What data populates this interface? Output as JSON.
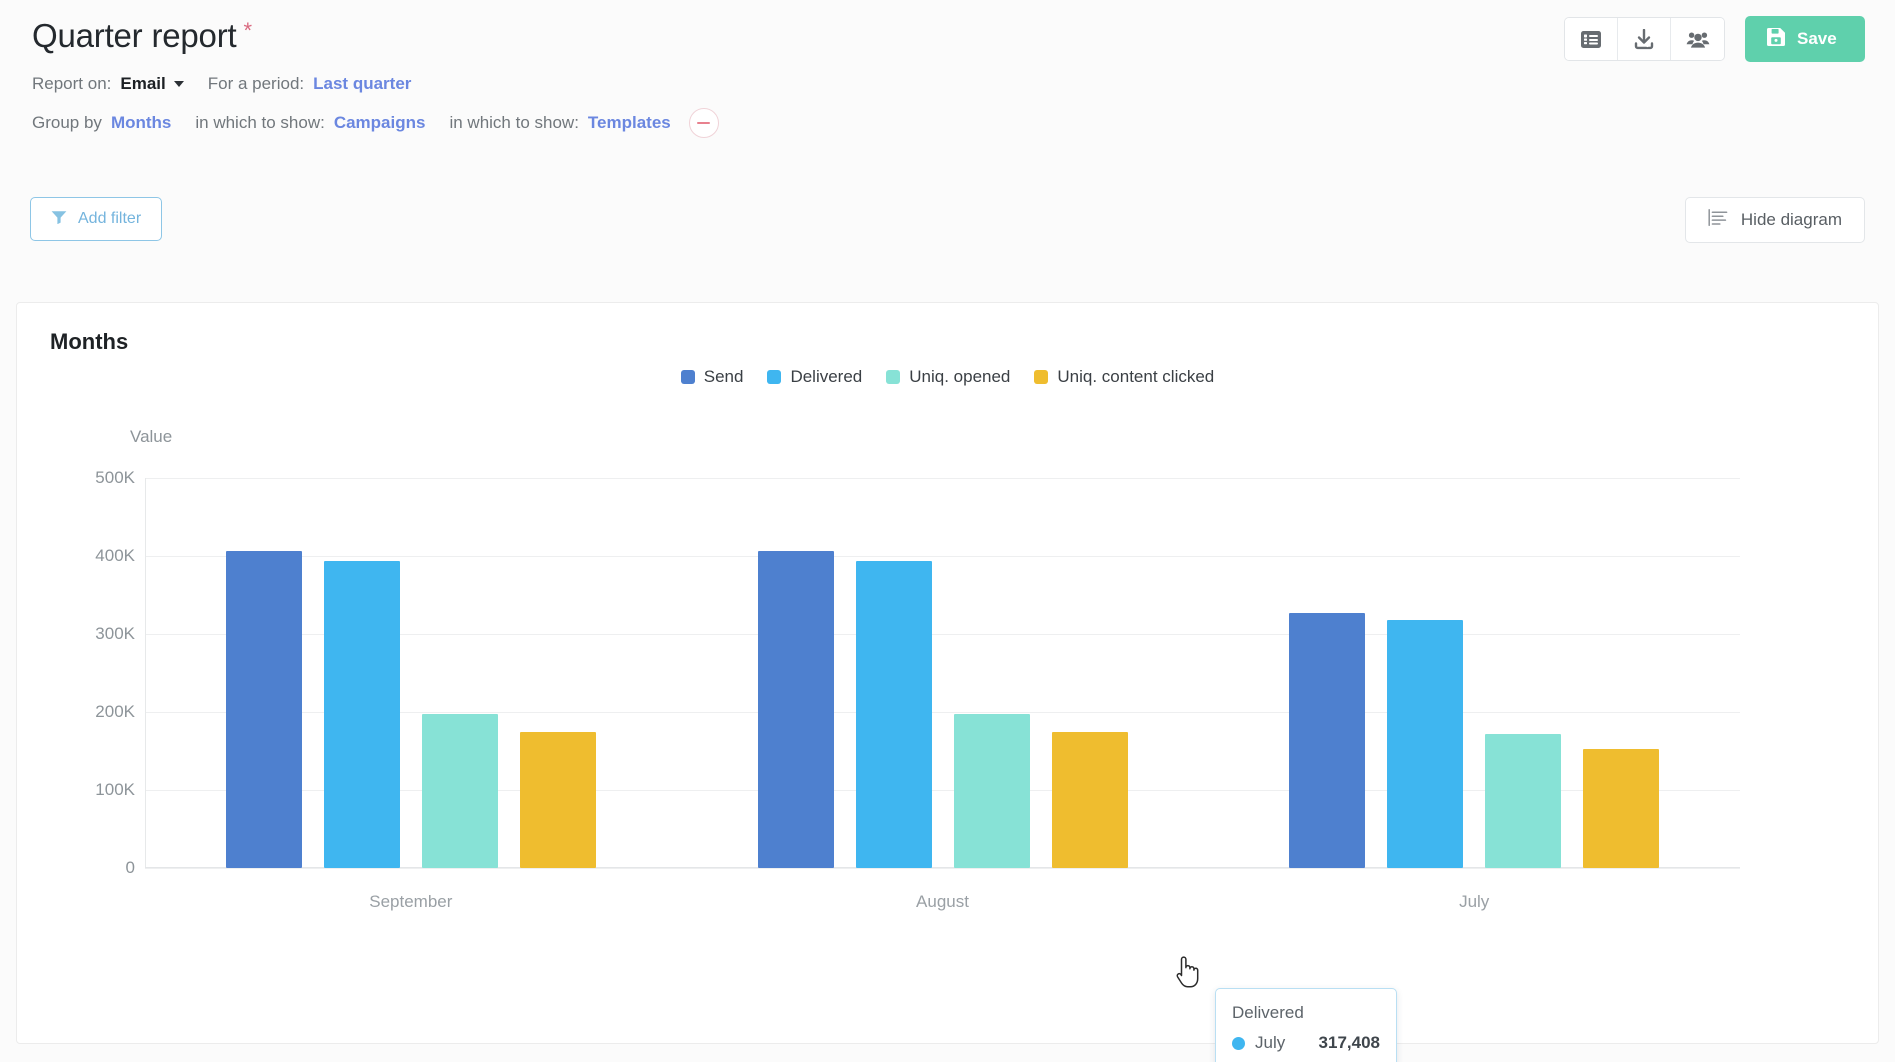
{
  "header": {
    "title": "Quarter report",
    "required_marker": "*",
    "actions": {
      "table_view_label": "table-view",
      "download_label": "download",
      "share_label": "share",
      "save_label": "Save"
    },
    "report_on_label": "Report on:",
    "report_on_value": "Email",
    "period_label": "For a period:",
    "period_value": "Last quarter",
    "group_by_label": "Group by",
    "group_by_value": "Months",
    "show_label_1": "in which to show:",
    "show_value_1": "Campaigns",
    "show_label_2": "in which to show:",
    "show_value_2": "Templates",
    "remove_label": "remove-grouping"
  },
  "toolbar": {
    "add_filter_label": "Add filter",
    "hide_diagram_label": "Hide diagram"
  },
  "card": {
    "title": "Months"
  },
  "tooltip": {
    "series": "Delivered",
    "category": "July",
    "value": "317,408",
    "dot_color": "#3fb6f0"
  },
  "colors": {
    "send": "#4e80cf",
    "delivered": "#3fb6f0",
    "uniq_opened": "#87e2d6",
    "uniq_content_clicked": "#efbd2f",
    "accent_green": "#5fd0ac",
    "link_blue": "#6b87e0",
    "required_red": "#d9697f"
  },
  "chart_data": {
    "type": "bar",
    "title": "Months",
    "xlabel": "",
    "ylabel": "Value",
    "ylim": [
      0,
      500000
    ],
    "yticks": [
      "0",
      "100K",
      "200K",
      "300K",
      "400K",
      "500K"
    ],
    "ytick_values": [
      0,
      100000,
      200000,
      300000,
      400000,
      500000
    ],
    "grid": true,
    "legend_position": "top-center",
    "categories": [
      "September",
      "August",
      "July"
    ],
    "series": [
      {
        "name": "Send",
        "color": "#4e80cf",
        "values": [
          406000,
          406000,
          327000
        ]
      },
      {
        "name": "Delivered",
        "color": "#3fb6f0",
        "values": [
          394000,
          394000,
          317408
        ]
      },
      {
        "name": "Uniq. opened",
        "color": "#87e2d6",
        "values": [
          197000,
          198000,
          172000
        ]
      },
      {
        "name": "Uniq. content clicked",
        "color": "#efbd2f",
        "values": [
          175000,
          175000,
          152000
        ]
      }
    ]
  }
}
